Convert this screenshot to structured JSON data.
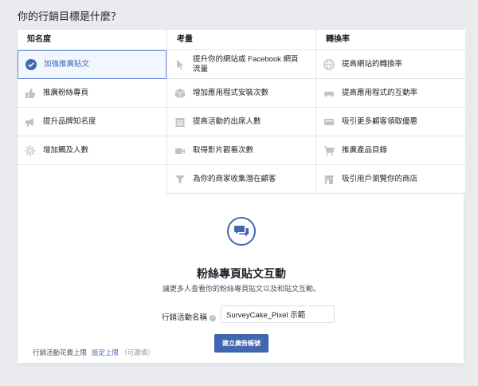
{
  "page": {
    "title": "你的行銷目標是什麼？"
  },
  "colors": {
    "accent": "#4267b2",
    "selected_bg": "#f2f6ff",
    "icon": "#bec2c9"
  },
  "columns": [
    {
      "header": "知名度",
      "items": [
        {
          "label": "加強推廣貼文",
          "icon": "check-circle-icon",
          "selected": true
        },
        {
          "label": "推廣粉絲專頁",
          "icon": "thumbs-up-icon",
          "selected": false
        },
        {
          "label": "提升品牌知名度",
          "icon": "megaphone-icon",
          "selected": false
        },
        {
          "label": "增加觸及人數",
          "icon": "sparkle-icon",
          "selected": false
        }
      ]
    },
    {
      "header": "考量",
      "items": [
        {
          "label": "提升你的網站或 Facebook 網頁流量",
          "icon": "cursor-icon",
          "selected": false
        },
        {
          "label": "增加應用程式安裝次數",
          "icon": "box-icon",
          "selected": false
        },
        {
          "label": "提高活動的出席人數",
          "icon": "calendar-icon",
          "selected": false
        },
        {
          "label": "取得影片觀看次數",
          "icon": "video-camera-icon",
          "selected": false
        },
        {
          "label": "為你的商家收集潛在顧客",
          "icon": "funnel-icon",
          "selected": false
        }
      ]
    },
    {
      "header": "轉換率",
      "items": [
        {
          "label": "提高網站的轉換率",
          "icon": "globe-icon",
          "selected": false
        },
        {
          "label": "提高應用程式的互動率",
          "icon": "gamepad-icon",
          "selected": false
        },
        {
          "label": "吸引更多顧客領取優惠",
          "icon": "coupon-icon",
          "selected": false
        },
        {
          "label": "推廣產品目錄",
          "icon": "cart-icon",
          "selected": false
        },
        {
          "label": "吸引用戶瀏覽你的商店",
          "icon": "store-icon",
          "selected": false
        }
      ]
    }
  ],
  "detail": {
    "icon": "chat-bubbles-icon",
    "title": "粉絲專頁貼文互動",
    "description": "讓更多人查看你的粉絲專頁貼文以及和貼文互動。",
    "campaign_name_label": "行銷活動名稱",
    "campaign_name_value": "SurveyCake_Pixel 示範",
    "create_button": "建立廣告帳號"
  },
  "footer": {
    "label": "行銷活動花費上限",
    "link": "設定上限",
    "note": "（可選填）"
  }
}
